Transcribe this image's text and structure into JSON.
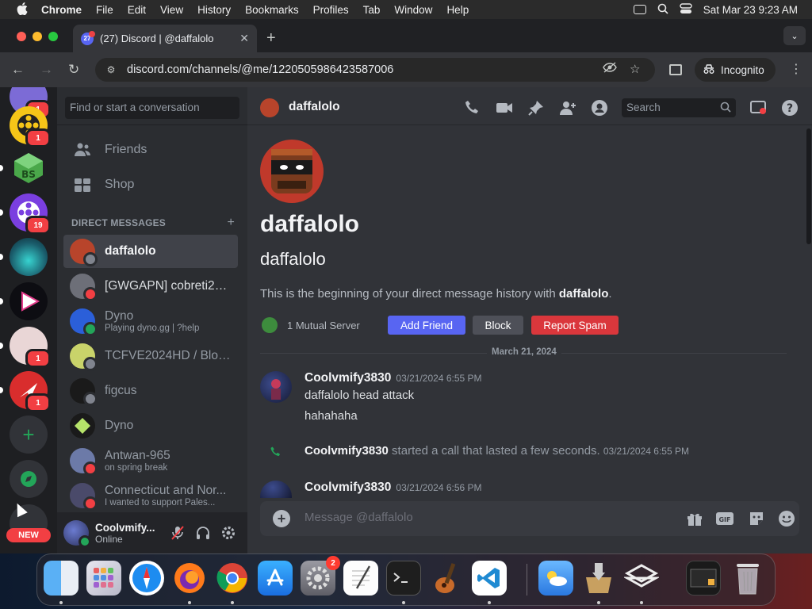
{
  "menubar": {
    "app": "Chrome",
    "items": [
      "File",
      "Edit",
      "View",
      "History",
      "Bookmarks",
      "Profiles",
      "Tab",
      "Window",
      "Help"
    ],
    "datetime": "Sat Mar 23  9:23 AM"
  },
  "browser": {
    "tab_title": "(27) Discord | @daffalolo",
    "tab_badge": "27",
    "url": "discord.com/channels/@me/1220505986423587006",
    "incognito_label": "Incognito"
  },
  "guilds": {
    "badges": [
      "1",
      "1",
      "19",
      "1",
      "1"
    ],
    "new_label": "NEW"
  },
  "dm_sidebar": {
    "search_placeholder": "Find or start a conversation",
    "nav": [
      {
        "label": "Friends",
        "icon": "friends-icon"
      },
      {
        "label": "Shop",
        "icon": "shop-icon"
      }
    ],
    "section_title": "DIRECT MESSAGES",
    "items": [
      {
        "name": "daffalolo",
        "sub": "",
        "status": "offline",
        "active": true
      },
      {
        "name": "[GWGAPN] cobreti21 ...",
        "sub": "",
        "status": "dnd"
      },
      {
        "name": "Dyno",
        "sub": "Playing dyno.gg | ?help",
        "status": "online"
      },
      {
        "name": "TCFVE2024HD / Bloq...",
        "sub": "",
        "status": "offline"
      },
      {
        "name": "figcus",
        "sub": "",
        "status": "offline"
      },
      {
        "name": "Dyno",
        "sub": "",
        "status": "none"
      },
      {
        "name": "Antwan-965",
        "sub": "on spring break",
        "status": "dnd"
      },
      {
        "name": "Connecticut and Nor...",
        "sub": "I wanted to support Pales...",
        "status": "dnd"
      }
    ],
    "user": {
      "name": "Coolvmify...",
      "status": "Online"
    }
  },
  "chat": {
    "header_name": "daffalolo",
    "search_placeholder": "Search",
    "intro_title": "daffalolo",
    "intro_subtitle": "daffalolo",
    "intro_text_prefix": "This is the beginning of your direct message history with ",
    "intro_text_bold": "daffalolo",
    "intro_text_suffix": ".",
    "mutual_servers": "1 Mutual Server",
    "add_friend_label": "Add Friend",
    "block_label": "Block",
    "report_label": "Report Spam",
    "date_divider": "March 21, 2024",
    "messages": [
      {
        "author": "Coolvmify3830",
        "time": "03/21/2024 6:55 PM",
        "lines": [
          "daffalolo head attack",
          "hahahaha"
        ]
      },
      {
        "author": "Coolvmify3830",
        "time": "03/21/2024 6:56 PM",
        "lines": []
      }
    ],
    "call": {
      "author": "Coolvmify3830",
      "text": " started a call that lasted a few seconds. ",
      "time": "03/21/2024 6:55 PM"
    },
    "composer_placeholder": "Message @daffalolo"
  },
  "dock": {
    "settings_badge": "2"
  },
  "colors": {
    "blurple": "#5865f2",
    "block_grey": "#4e5058",
    "report_red": "#da373c",
    "online": "#23a559"
  }
}
